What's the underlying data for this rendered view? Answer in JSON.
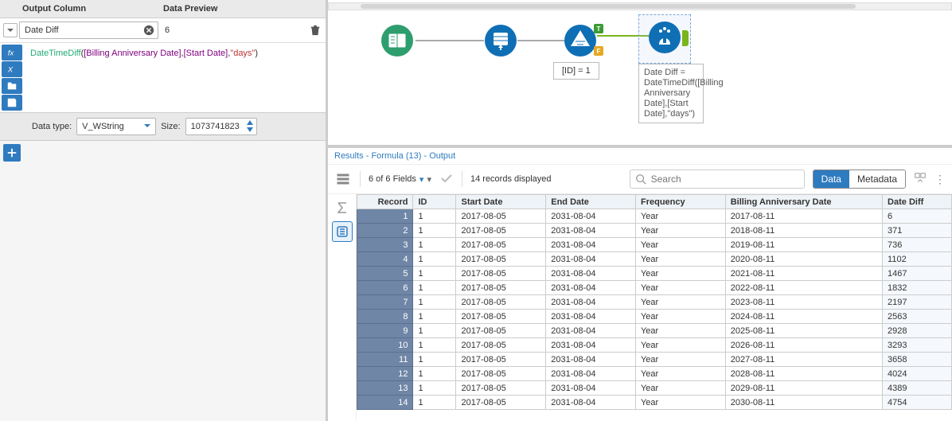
{
  "config": {
    "output_column_label": "Output Column",
    "data_preview_label": "Data Preview",
    "output_column_value": "Date Diff",
    "data_preview_value": "6",
    "formula_fn": "DateTimeDiff",
    "formula_f1": "[Billing Anniversary Date]",
    "formula_f2": "[Start Date]",
    "formula_str": "\"days\"",
    "data_type_label": "Data type:",
    "data_type_value": "V_WString",
    "size_label": "Size:",
    "size_value": "1073741823"
  },
  "canvas": {
    "filter_label": "[ID] = 1",
    "note_text": "Date Diff = DateTimeDiff([Billing Anniversary Date],[Start Date],\"days\")"
  },
  "results": {
    "title": "Results - Formula (13) - Output",
    "fields_text": "6 of 6 Fields",
    "records_text": "14 records displayed",
    "search_placeholder": "Search",
    "data_btn": "Data",
    "metadata_btn": "Metadata",
    "columns": [
      "Record",
      "ID",
      "Start Date",
      "End Date",
      "Frequency",
      "Billing Anniversary Date",
      "Date Diff"
    ]
  },
  "chart_data": {
    "type": "table",
    "columns": [
      "Record",
      "ID",
      "Start Date",
      "End Date",
      "Frequency",
      "Billing Anniversary Date",
      "Date Diff"
    ],
    "rows": [
      {
        "Record": 1,
        "ID": 1,
        "Start Date": "2017-08-05",
        "End Date": "2031-08-04",
        "Frequency": "Year",
        "Billing Anniversary Date": "2017-08-11",
        "Date Diff": 6
      },
      {
        "Record": 2,
        "ID": 1,
        "Start Date": "2017-08-05",
        "End Date": "2031-08-04",
        "Frequency": "Year",
        "Billing Anniversary Date": "2018-08-11",
        "Date Diff": 371
      },
      {
        "Record": 3,
        "ID": 1,
        "Start Date": "2017-08-05",
        "End Date": "2031-08-04",
        "Frequency": "Year",
        "Billing Anniversary Date": "2019-08-11",
        "Date Diff": 736
      },
      {
        "Record": 4,
        "ID": 1,
        "Start Date": "2017-08-05",
        "End Date": "2031-08-04",
        "Frequency": "Year",
        "Billing Anniversary Date": "2020-08-11",
        "Date Diff": 1102
      },
      {
        "Record": 5,
        "ID": 1,
        "Start Date": "2017-08-05",
        "End Date": "2031-08-04",
        "Frequency": "Year",
        "Billing Anniversary Date": "2021-08-11",
        "Date Diff": 1467
      },
      {
        "Record": 6,
        "ID": 1,
        "Start Date": "2017-08-05",
        "End Date": "2031-08-04",
        "Frequency": "Year",
        "Billing Anniversary Date": "2022-08-11",
        "Date Diff": 1832
      },
      {
        "Record": 7,
        "ID": 1,
        "Start Date": "2017-08-05",
        "End Date": "2031-08-04",
        "Frequency": "Year",
        "Billing Anniversary Date": "2023-08-11",
        "Date Diff": 2197
      },
      {
        "Record": 8,
        "ID": 1,
        "Start Date": "2017-08-05",
        "End Date": "2031-08-04",
        "Frequency": "Year",
        "Billing Anniversary Date": "2024-08-11",
        "Date Diff": 2563
      },
      {
        "Record": 9,
        "ID": 1,
        "Start Date": "2017-08-05",
        "End Date": "2031-08-04",
        "Frequency": "Year",
        "Billing Anniversary Date": "2025-08-11",
        "Date Diff": 2928
      },
      {
        "Record": 10,
        "ID": 1,
        "Start Date": "2017-08-05",
        "End Date": "2031-08-04",
        "Frequency": "Year",
        "Billing Anniversary Date": "2026-08-11",
        "Date Diff": 3293
      },
      {
        "Record": 11,
        "ID": 1,
        "Start Date": "2017-08-05",
        "End Date": "2031-08-04",
        "Frequency": "Year",
        "Billing Anniversary Date": "2027-08-11",
        "Date Diff": 3658
      },
      {
        "Record": 12,
        "ID": 1,
        "Start Date": "2017-08-05",
        "End Date": "2031-08-04",
        "Frequency": "Year",
        "Billing Anniversary Date": "2028-08-11",
        "Date Diff": 4024
      },
      {
        "Record": 13,
        "ID": 1,
        "Start Date": "2017-08-05",
        "End Date": "2031-08-04",
        "Frequency": "Year",
        "Billing Anniversary Date": "2029-08-11",
        "Date Diff": 4389
      },
      {
        "Record": 14,
        "ID": 1,
        "Start Date": "2017-08-05",
        "End Date": "2031-08-04",
        "Frequency": "Year",
        "Billing Anniversary Date": "2030-08-11",
        "Date Diff": 4754
      }
    ]
  }
}
